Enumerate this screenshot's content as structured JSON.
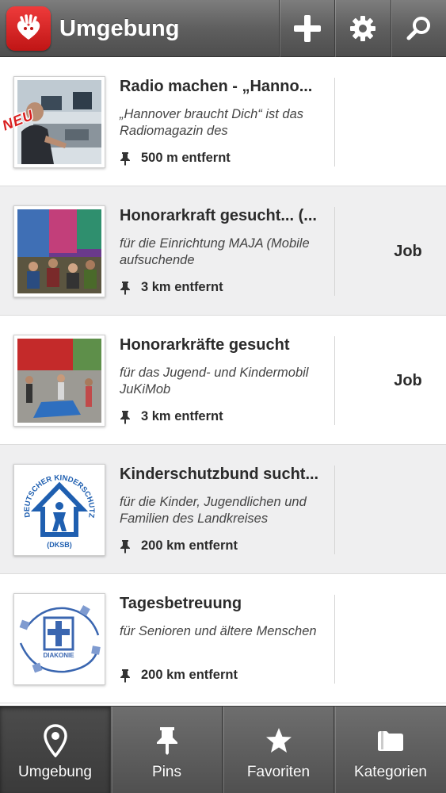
{
  "header": {
    "title": "Umgebung",
    "icons": [
      "add-icon",
      "settings-gear-icon",
      "search-icon"
    ]
  },
  "list": {
    "new_badge": "NEU",
    "items": [
      {
        "title": "Radio machen - „Hanno...",
        "description": "„Hannover braucht Dich“ ist das Radiomagazin des",
        "distance": "500 m entfernt",
        "tag": "",
        "image": "radio-studio-photo"
      },
      {
        "title": "Honorarkraft gesucht... (...",
        "description": "für die Einrichtung MAJA (Mobile aufsuchende",
        "distance": "3 km entfernt",
        "tag": "Job",
        "image": "youth-group-photo"
      },
      {
        "title": "Honorarkräfte gesucht",
        "description": "für das Jugend- und Kindermobil JuKiMob",
        "distance": "3 km entfernt",
        "tag": "Job",
        "image": "kids-playing-photo"
      },
      {
        "title": "Kinderschutzbund sucht...",
        "description": "für die Kinder, Jugendlichen und Familien des Landkreises",
        "distance": "200 km entfernt",
        "tag": "",
        "image": "kinderschutzbund-logo",
        "logo_text": "DEUTSCHER KINDERSCHUTZBUND E.V.",
        "logo_subtext": "(DKSB)"
      },
      {
        "title": "Tagesbetreuung",
        "description": "für Senioren und ältere Menschen",
        "distance": "200 km entfernt",
        "tag": "",
        "image": "diakonie-logo",
        "logo_text": "DIAKONIE"
      }
    ]
  },
  "tabbar": {
    "tabs": [
      {
        "label": "Umgebung",
        "icon": "location-pin-icon",
        "active": true
      },
      {
        "label": "Pins",
        "icon": "pushpin-icon",
        "active": false
      },
      {
        "label": "Favoriten",
        "icon": "star-icon",
        "active": false
      },
      {
        "label": "Kategorien",
        "icon": "folder-icon",
        "active": false
      }
    ]
  },
  "colors": {
    "header_bg": "#616161",
    "logo_red": "#d92626",
    "new_badge": "#d91f1f",
    "alt_row_bg": "#efeff0"
  }
}
